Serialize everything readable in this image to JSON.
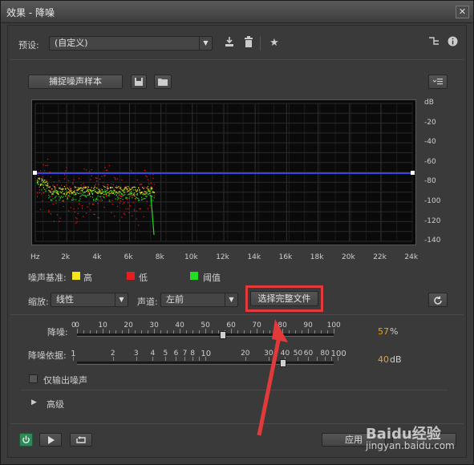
{
  "window": {
    "title": "效果 - 降噪",
    "close": "✕"
  },
  "preset": {
    "label": "预设:",
    "value": "(自定义)"
  },
  "capture_button": "捕捉噪声样本",
  "graph": {
    "db_labels": [
      "dB",
      "-20",
      "-40",
      "-60",
      "-80",
      "-100",
      "-120",
      "-140"
    ],
    "hz_labels": [
      "Hz",
      "2k",
      "4k",
      "6k",
      "8k",
      "10k",
      "12k",
      "14k",
      "16k",
      "18k",
      "20k",
      "22k",
      "24k"
    ]
  },
  "noise_floor": {
    "label": "噪声基准:",
    "high": "高",
    "low": "低",
    "threshold": "阈值",
    "high_color": "#f5e61a",
    "low_color": "#e81e1e",
    "threshold_color": "#22dd22"
  },
  "scale": {
    "label": "缩放:",
    "value": "线性"
  },
  "channel": {
    "label": "声道:",
    "value": "左前"
  },
  "select_file_button": "选择完整文件",
  "reduction": {
    "label": "降噪:",
    "ticks": [
      "0",
      "0",
      "10",
      "20",
      "30",
      "40",
      "50",
      "60",
      "70",
      "80",
      "90",
      "100"
    ],
    "value": "57",
    "unit": "%",
    "fraction": 0.57
  },
  "reduce_by": {
    "label": "降噪依据:",
    "ticks": [
      "1",
      "2",
      "3",
      "4",
      "5",
      "6",
      "7",
      "8",
      "10",
      "20",
      "30",
      "40",
      "50",
      "60",
      "80",
      "100"
    ],
    "value": "40",
    "unit": "dB"
  },
  "output_noise_only": {
    "label": "仅输出噪声",
    "checked": false
  },
  "advanced": {
    "label": "高级"
  },
  "apply_button": "应用",
  "watermark": {
    "text": "Baidu经验",
    "sub": "jingyan.baidu.com"
  }
}
